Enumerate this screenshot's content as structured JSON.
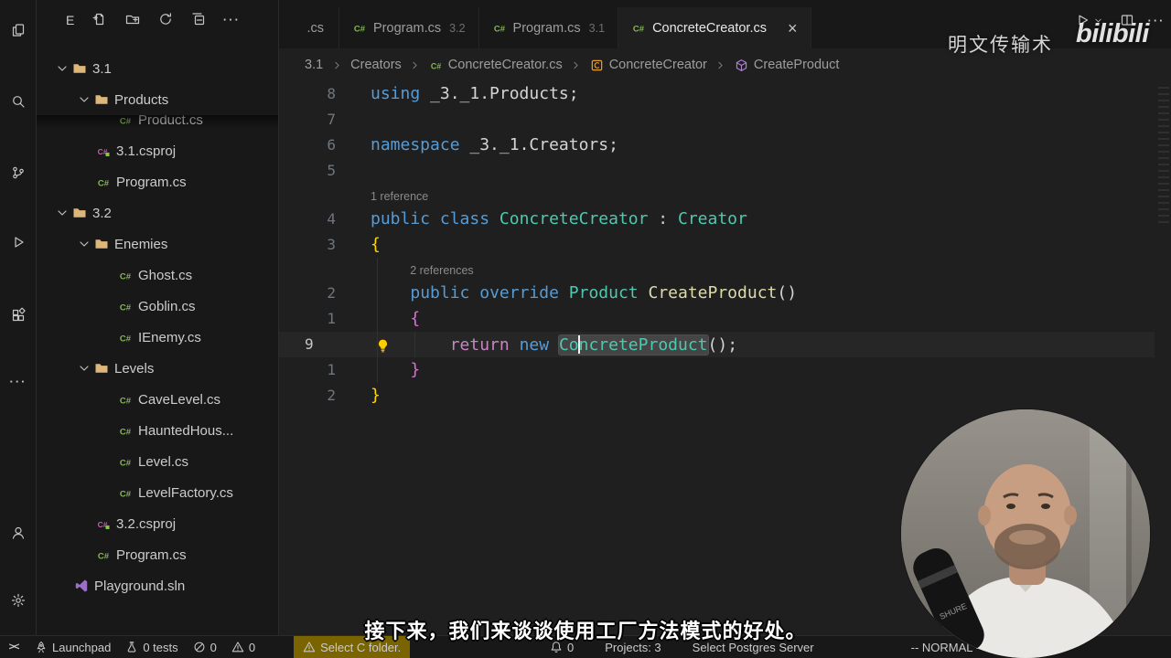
{
  "watermark": {
    "text": "明文传输术",
    "logo": "bilibili"
  },
  "activity_bar": {
    "icons": [
      "files",
      "search",
      "source-control",
      "run-debug",
      "extensions",
      "more"
    ],
    "bottom_icons": [
      "account",
      "settings"
    ]
  },
  "explorer": {
    "header": {
      "title": "E",
      "actions": [
        "new-file",
        "new-folder",
        "refresh",
        "collapse-all",
        "more"
      ]
    },
    "tree": [
      {
        "label": "3.1",
        "kind": "folder",
        "depth": 0,
        "expanded": true
      },
      {
        "label": "Products",
        "kind": "folder",
        "depth": 1,
        "expanded": true
      },
      {
        "label": "Product.cs",
        "kind": "cs",
        "depth": 2
      },
      {
        "label": "3.1.csproj",
        "kind": "csproj",
        "depth": 1
      },
      {
        "label": "Program.cs",
        "kind": "cs",
        "depth": 1
      },
      {
        "label": "3.2",
        "kind": "folder",
        "depth": 0,
        "expanded": true
      },
      {
        "label": "Enemies",
        "kind": "folder",
        "depth": 1,
        "expanded": true
      },
      {
        "label": "Ghost.cs",
        "kind": "cs",
        "depth": 2
      },
      {
        "label": "Goblin.cs",
        "kind": "cs",
        "depth": 2
      },
      {
        "label": "IEnemy.cs",
        "kind": "cs",
        "depth": 2
      },
      {
        "label": "Levels",
        "kind": "folder",
        "depth": 1,
        "expanded": true
      },
      {
        "label": "CaveLevel.cs",
        "kind": "cs",
        "depth": 2
      },
      {
        "label": "HauntedHous...",
        "kind": "cs",
        "depth": 2
      },
      {
        "label": "Level.cs",
        "kind": "cs",
        "depth": 2
      },
      {
        "label": "LevelFactory.cs",
        "kind": "cs",
        "depth": 2
      },
      {
        "label": "3.2.csproj",
        "kind": "csproj",
        "depth": 1
      },
      {
        "label": "Program.cs",
        "kind": "cs",
        "depth": 1
      },
      {
        "label": "Playground.sln",
        "kind": "sln",
        "depth": 0
      }
    ]
  },
  "tabs": [
    {
      "label": ".cs",
      "dir": "",
      "active": false,
      "partial": true
    },
    {
      "label": "Program.cs",
      "dir": "3.2",
      "active": false
    },
    {
      "label": "Program.cs",
      "dir": "3.1",
      "active": false
    },
    {
      "label": "ConcreteCreator.cs",
      "dir": "",
      "active": true,
      "close": "×"
    }
  ],
  "editor_actions": [
    "run",
    "split-editor",
    "more"
  ],
  "breadcrumb": [
    {
      "label": "3.1"
    },
    {
      "label": "Creators"
    },
    {
      "label": "ConcreteCreator.cs",
      "icon": "cs"
    },
    {
      "label": "ConcreteCreator",
      "icon": "symbol-class"
    },
    {
      "label": "CreateProduct",
      "icon": "symbol-method"
    }
  ],
  "editor": {
    "lines": [
      {
        "num": "8",
        "tokens": [
          {
            "t": "using",
            "c": "kw"
          },
          {
            "t": " _3._1.Products;",
            "c": "pl"
          }
        ]
      },
      {
        "num": "7",
        "tokens": []
      },
      {
        "num": "6",
        "tokens": [
          {
            "t": "namespace",
            "c": "kw"
          },
          {
            "t": " _3._1.Creators;",
            "c": "pl"
          }
        ]
      },
      {
        "num": "5",
        "tokens": []
      },
      {
        "lens": "1 reference",
        "indent": 0
      },
      {
        "num": "4",
        "tokens": [
          {
            "t": "public",
            "c": "kw"
          },
          {
            "t": " ",
            "c": "pl"
          },
          {
            "t": "class",
            "c": "kw"
          },
          {
            "t": " ",
            "c": "pl"
          },
          {
            "t": "ConcreteCreator",
            "c": "ty"
          },
          {
            "t": " : ",
            "c": "pl"
          },
          {
            "t": "Creator",
            "c": "ty"
          }
        ]
      },
      {
        "num": "3",
        "tokens": [
          {
            "t": "{",
            "c": "b1"
          }
        ]
      },
      {
        "lens": "2 references",
        "indent": 4
      },
      {
        "num": "2",
        "tokens": [
          {
            "t": "    ",
            "c": "pl"
          },
          {
            "t": "public",
            "c": "kw"
          },
          {
            "t": " ",
            "c": "pl"
          },
          {
            "t": "override",
            "c": "kw"
          },
          {
            "t": " ",
            "c": "pl"
          },
          {
            "t": "Product",
            "c": "ty"
          },
          {
            "t": " ",
            "c": "pl"
          },
          {
            "t": "CreateProduct",
            "c": "me"
          },
          {
            "t": "()",
            "c": "pl"
          }
        ]
      },
      {
        "num": "1",
        "tokens": [
          {
            "t": "    ",
            "c": "pl"
          },
          {
            "t": "{",
            "c": "b2"
          }
        ]
      },
      {
        "num": "9",
        "current": true,
        "lightbulb": true,
        "tokens": [
          {
            "t": "        ",
            "c": "pl"
          },
          {
            "t": "return",
            "c": "ctl"
          },
          {
            "t": " ",
            "c": "pl"
          },
          {
            "t": "new",
            "c": "kw"
          },
          {
            "t": " ",
            "c": "pl"
          },
          {
            "t": "ConcreteProduct",
            "c": "ty",
            "highlight": true,
            "cursor_after": 2
          },
          {
            "t": "();",
            "c": "pl"
          }
        ]
      },
      {
        "num": "1",
        "tokens": [
          {
            "t": "    ",
            "c": "pl"
          },
          {
            "t": "}",
            "c": "b2"
          }
        ]
      },
      {
        "num": "2",
        "tokens": [
          {
            "t": "}",
            "c": "b1"
          }
        ]
      }
    ]
  },
  "status_bar": {
    "left": [
      {
        "icon": "remote",
        "label": "",
        "name": "remote-indicator"
      },
      {
        "icon": "rocket",
        "label": "Launchpad"
      },
      {
        "icon": "beaker",
        "label": "0 tests"
      },
      {
        "icon": "error",
        "label": "0"
      },
      {
        "icon": "warning",
        "label": "0"
      },
      {
        "icon": "warning",
        "label": "Select C folder.",
        "warn_bg": true
      }
    ],
    "right": [
      {
        "icon": "bell",
        "label": "0"
      },
      {
        "label": "Projects: 3"
      },
      {
        "label": "Select Postgres Server"
      },
      {
        "label": "-- NORMAL --",
        "vim": true
      }
    ]
  },
  "subtitle": "接下来，我们来谈谈使用工厂方法模式的好处。",
  "colors": {
    "keyword": "#569cd6",
    "control": "#c586c0",
    "type": "#4ec9b0",
    "method": "#dcdcaa",
    "bracket1": "#ffd700",
    "bracket2": "#da70d6",
    "warning_bg": "#7a6400",
    "folder": "#dcb67a"
  }
}
